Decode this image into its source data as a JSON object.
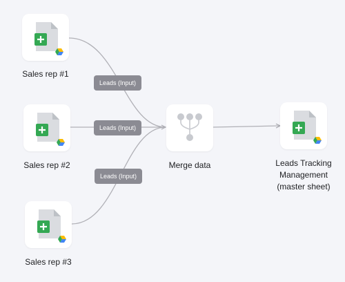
{
  "nodes": {
    "rep1": {
      "label": "Sales rep #1",
      "icon": "google-sheets-icon"
    },
    "rep2": {
      "label": "Sales rep #2",
      "icon": "google-sheets-icon"
    },
    "rep3": {
      "label": "Sales rep #3",
      "icon": "google-sheets-icon"
    },
    "merge": {
      "label": "Merge data",
      "icon": "merge-icon"
    },
    "master": {
      "label_lines": [
        "Leads Tracking",
        "Management",
        "(master sheet)"
      ],
      "icon": "google-sheets-icon"
    }
  },
  "edges": {
    "rep1_to_merge": {
      "label": "Leads (Input)"
    },
    "rep2_to_merge": {
      "label": "Leads (Input)"
    },
    "rep3_to_merge": {
      "label": "Leads (Input)"
    }
  },
  "colors": {
    "background": "#f4f5f9",
    "connector": "#b0b0b6",
    "chip": "#8b8b93",
    "sheets_green": "#34a853",
    "drive_yellow": "#fbbc04",
    "drive_blue": "#4285f4",
    "merge_icon": "#c8cacf"
  }
}
